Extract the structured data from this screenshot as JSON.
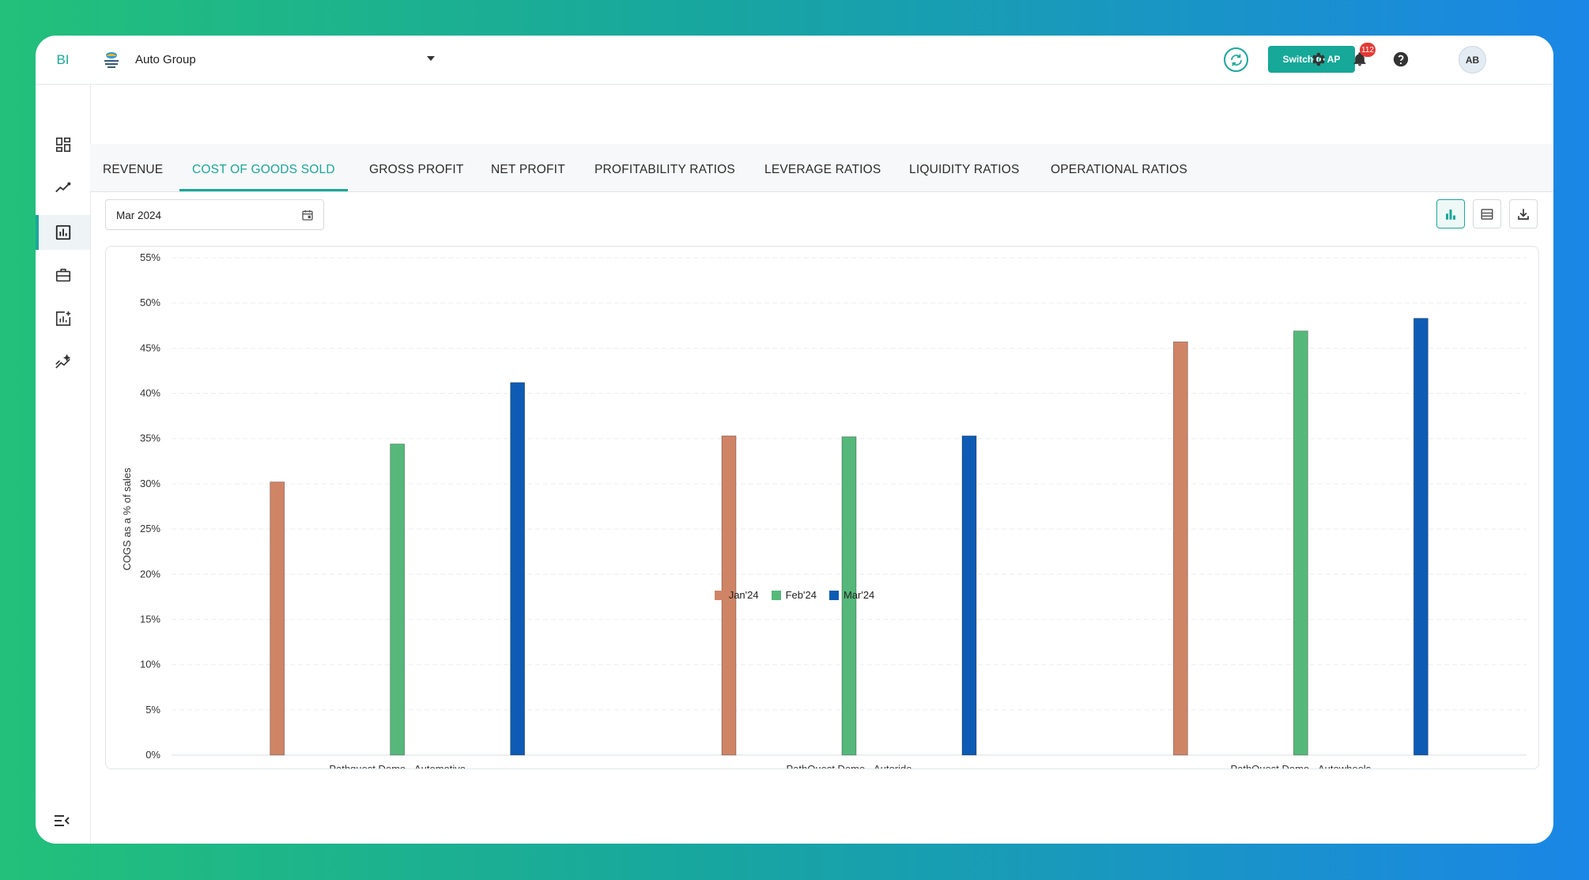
{
  "app": {
    "brand": "BI"
  },
  "sidebar": {
    "items": [
      {
        "name": "dashboard",
        "icon": "dashboard-icon"
      },
      {
        "name": "trends",
        "icon": "trend-line-icon"
      },
      {
        "name": "reports",
        "icon": "bar-chart-icon",
        "active": true
      },
      {
        "name": "portfolio",
        "icon": "briefcase-icon"
      },
      {
        "name": "add-report",
        "icon": "add-chart-icon"
      },
      {
        "name": "insights",
        "icon": "sparkle-chart-icon"
      }
    ],
    "collapse_icon": "collapse-menu-icon"
  },
  "header": {
    "org_name": "Auto Group",
    "switch_label": "Switch to AP",
    "notification_count": "112",
    "avatar_initials": "AB"
  },
  "tabs": [
    {
      "label": "REVENUE"
    },
    {
      "label": "COST OF GOODS SOLD",
      "active": true
    },
    {
      "label": "GROSS PROFIT"
    },
    {
      "label": "NET PROFIT"
    },
    {
      "label": "PROFITABILITY RATIOS"
    },
    {
      "label": "LEVERAGE RATIOS"
    },
    {
      "label": "LIQUIDITY RATIOS"
    },
    {
      "label": "OPERATIONAL RATIOS"
    }
  ],
  "filters": {
    "date_value": "Mar 2024"
  },
  "colors": {
    "accent": "#19a89a",
    "jan": "#cf8466",
    "feb": "#55b87a",
    "mar": "#0e5bb5"
  },
  "chart_data": {
    "type": "bar",
    "categories": [
      "Pathquest Demo - Automotive",
      "PathQuest Demo - Autoride",
      "PathQuest Demo - Autowheels"
    ],
    "series": [
      {
        "name": "Jan'24",
        "values": [
          30.2,
          35.3,
          45.7
        ]
      },
      {
        "name": "Feb'24",
        "values": [
          34.4,
          35.2,
          46.9
        ]
      },
      {
        "name": "Mar'24",
        "values": [
          41.2,
          35.3,
          48.3
        ]
      }
    ],
    "ylabel": "COGS as a % of sales",
    "ylim": [
      0,
      55
    ],
    "y_ticks": [
      "0%",
      "5%",
      "10%",
      "15%",
      "20%",
      "25%",
      "30%",
      "35%",
      "40%",
      "45%",
      "50%",
      "55%"
    ],
    "grid": true,
    "legend_position": "bottom-center"
  }
}
